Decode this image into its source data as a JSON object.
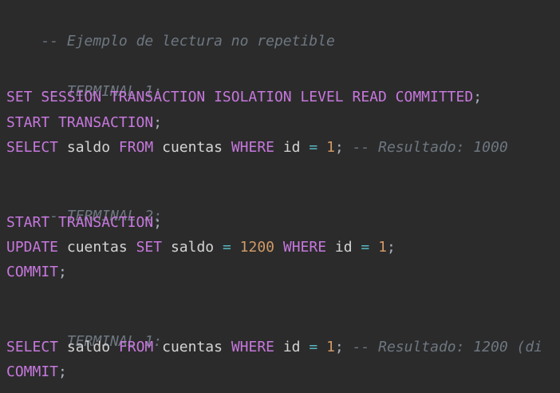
{
  "colors": {
    "background": "#2b2b2b",
    "keyword": "#c678dd",
    "comment": "#6e7781",
    "number": "#d19a66",
    "operator": "#56b6c2",
    "identifier": "#d4d4d4"
  },
  "code": {
    "l1": {
      "comment": "-- Ejemplo de lectura no repetible"
    },
    "l3": {
      "comment": "-- TERMINAL 1:"
    },
    "l4": {
      "k1": "SET SESSION TRANSACTION ISOLATION LEVEL READ COMMITTED",
      "semi": ";"
    },
    "l5": {
      "k1": "START TRANSACTION",
      "semi": ";"
    },
    "l6": {
      "k1": "SELECT",
      "i1": "saldo",
      "k2": "FROM",
      "i2": "cuentas",
      "k3": "WHERE",
      "i3": "id",
      "op": "=",
      "n1": "1",
      "semi": ";",
      "comment": "-- Resultado: 1000"
    },
    "l8": {
      "comment": "-- TERMINAL 2:"
    },
    "l9": {
      "k1": "START TRANSACTION",
      "semi": ";"
    },
    "l10": {
      "k1": "UPDATE",
      "i1": "cuentas",
      "k2": "SET",
      "i2": "saldo",
      "op1": "=",
      "n1": "1200",
      "k3": "WHERE",
      "i3": "id",
      "op2": "=",
      "n2": "1",
      "semi": ";"
    },
    "l11": {
      "k1": "COMMIT",
      "semi": ";"
    },
    "l13": {
      "comment": "-- TERMINAL 1:"
    },
    "l14": {
      "k1": "SELECT",
      "i1": "saldo",
      "k2": "FROM",
      "i2": "cuentas",
      "k3": "WHERE",
      "i3": "id",
      "op": "=",
      "n1": "1",
      "semi": ";",
      "comment": "-- Resultado: 1200 (di"
    },
    "l15": {
      "k1": "COMMIT",
      "semi": ";"
    }
  }
}
